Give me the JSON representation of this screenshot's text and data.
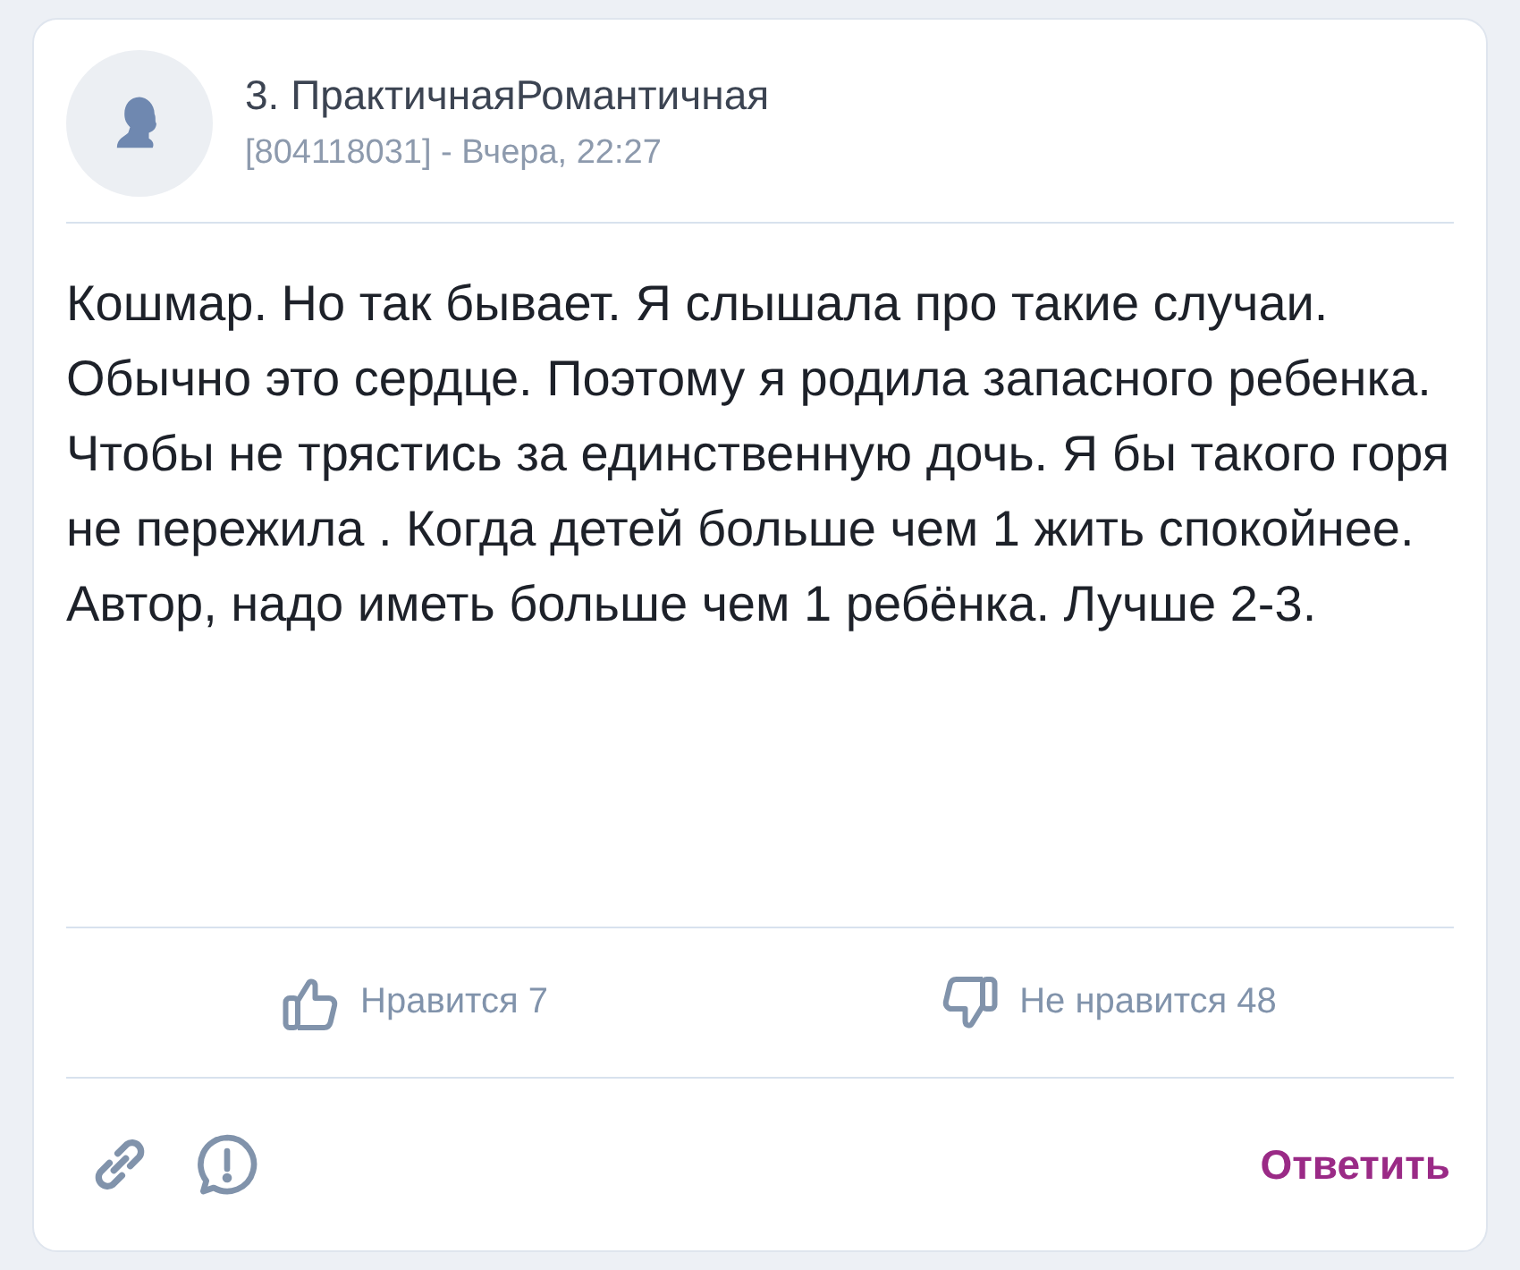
{
  "author": {
    "name": "3. ПрактичнаяРомантичная",
    "meta": "[804118031] - Вчера, 22:27"
  },
  "body": [
    "Кошмар. Но так бывает. Я слышала про такие случаи. Обычно это сердце. Поэтому я родила запасного ребенка. Чтобы не трястись за единственную дочь. Я бы такого горя не пережила . Когда детей больше чем 1 жить спокойнее.",
    "Автор, надо иметь больше чем 1 ребёнка. Лучше 2-3."
  ],
  "reactions": [
    {
      "kind": "like",
      "label": "Нравится 7"
    },
    {
      "kind": "dislike",
      "label": "Не нравится 48"
    }
  ],
  "reply": "Ответить"
}
